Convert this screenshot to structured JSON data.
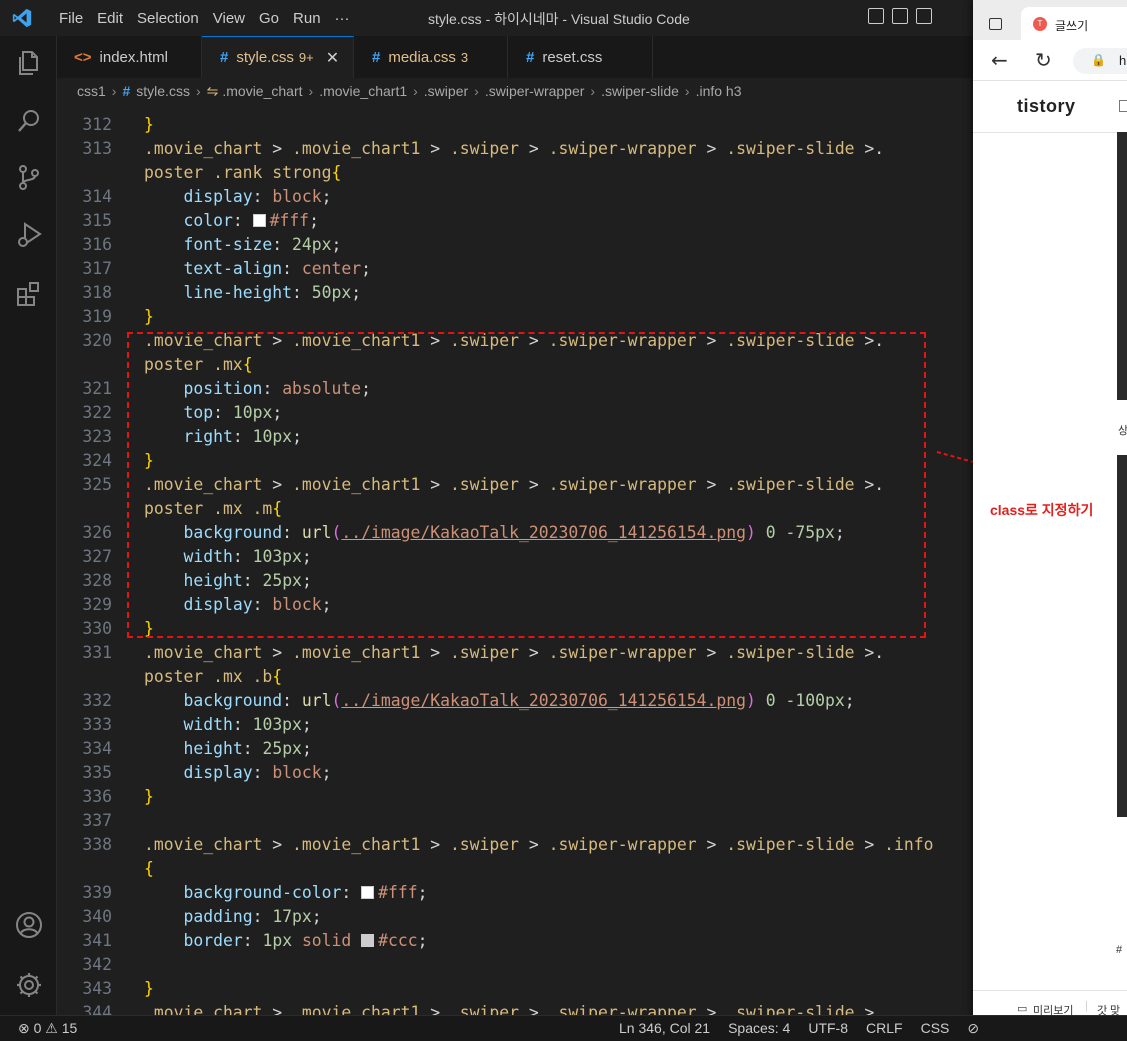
{
  "window": {
    "title": "style.css - 하이시네마 - Visual Studio Code",
    "menu": [
      "File",
      "Edit",
      "Selection",
      "View",
      "Go",
      "Run",
      "···"
    ]
  },
  "tabs": [
    {
      "label": "index.html",
      "icon": "<>",
      "badge": "",
      "active": false
    },
    {
      "label": "style.css",
      "icon": "#",
      "badge": "9+",
      "active": true,
      "close": "✕"
    },
    {
      "label": "media.css",
      "icon": "#",
      "badge": "3",
      "active": false
    },
    {
      "label": "reset.css",
      "icon": "#",
      "badge": "",
      "active": false
    }
  ],
  "breadcrumb": [
    "css1",
    "style.css",
    ".movie_chart",
    ".movie_chart1",
    ".swiper",
    ".swiper-wrapper",
    ".swiper-slide",
    ".info h3"
  ],
  "code_lines": [
    {
      "n": "312",
      "t": [
        [
          "brace",
          "}"
        ]
      ]
    },
    {
      "n": "313",
      "t": [
        [
          "sel",
          ".movie_chart"
        ],
        [
          "op",
          " > "
        ],
        [
          "sel",
          ".movie_chart1"
        ],
        [
          "op",
          " > "
        ],
        [
          "sel",
          ".swiper"
        ],
        [
          "op",
          " > "
        ],
        [
          "sel",
          ".swiper-wrapper"
        ],
        [
          "op",
          " > "
        ],
        [
          "sel",
          ".swiper-slide"
        ],
        [
          "op",
          " >."
        ]
      ]
    },
    {
      "n": "",
      "t": [
        [
          "sel",
          "poster .rank strong"
        ],
        [
          "brace",
          "{"
        ]
      ]
    },
    {
      "n": "314",
      "t": [
        [
          "op",
          "    "
        ],
        [
          "prop",
          "display"
        ],
        [
          "op",
          ": "
        ],
        [
          "val",
          "block"
        ],
        [
          "op",
          ";"
        ]
      ]
    },
    {
      "n": "315",
      "t": [
        [
          "op",
          "    "
        ],
        [
          "prop",
          "color"
        ],
        [
          "op",
          ": "
        ],
        [
          "swatch",
          "#ffffff"
        ],
        [
          "val",
          "#fff"
        ],
        [
          "op",
          ";"
        ]
      ]
    },
    {
      "n": "316",
      "t": [
        [
          "op",
          "    "
        ],
        [
          "prop",
          "font-size"
        ],
        [
          "op",
          ": "
        ],
        [
          "num",
          "24px"
        ],
        [
          "op",
          ";"
        ]
      ]
    },
    {
      "n": "317",
      "t": [
        [
          "op",
          "    "
        ],
        [
          "prop",
          "text-align"
        ],
        [
          "op",
          ": "
        ],
        [
          "val",
          "center"
        ],
        [
          "op",
          ";"
        ]
      ]
    },
    {
      "n": "318",
      "t": [
        [
          "op",
          "    "
        ],
        [
          "prop",
          "line-height"
        ],
        [
          "op",
          ": "
        ],
        [
          "num",
          "50px"
        ],
        [
          "op",
          ";"
        ]
      ]
    },
    {
      "n": "319",
      "t": [
        [
          "brace",
          "}"
        ]
      ]
    },
    {
      "n": "320",
      "t": [
        [
          "sel",
          ".movie_chart"
        ],
        [
          "op",
          " > "
        ],
        [
          "sel",
          ".movie_chart1"
        ],
        [
          "op",
          " > "
        ],
        [
          "sel",
          ".swiper"
        ],
        [
          "op",
          " > "
        ],
        [
          "sel",
          ".swiper-wrapper"
        ],
        [
          "op",
          " > "
        ],
        [
          "sel",
          ".swiper-slide"
        ],
        [
          "op",
          " >."
        ]
      ]
    },
    {
      "n": "",
      "t": [
        [
          "sel",
          "poster .mx"
        ],
        [
          "brace",
          "{"
        ]
      ]
    },
    {
      "n": "321",
      "t": [
        [
          "op",
          "    "
        ],
        [
          "prop",
          "position"
        ],
        [
          "op",
          ": "
        ],
        [
          "val",
          "absolute"
        ],
        [
          "op",
          ";"
        ]
      ]
    },
    {
      "n": "322",
      "t": [
        [
          "op",
          "    "
        ],
        [
          "prop",
          "top"
        ],
        [
          "op",
          ": "
        ],
        [
          "num",
          "10px"
        ],
        [
          "op",
          ";"
        ]
      ]
    },
    {
      "n": "323",
      "t": [
        [
          "op",
          "    "
        ],
        [
          "prop",
          "right"
        ],
        [
          "op",
          ": "
        ],
        [
          "num",
          "10px"
        ],
        [
          "op",
          ";"
        ]
      ]
    },
    {
      "n": "324",
      "t": [
        [
          "brace",
          "}"
        ]
      ]
    },
    {
      "n": "325",
      "t": [
        [
          "sel",
          ".movie_chart"
        ],
        [
          "op",
          " > "
        ],
        [
          "sel",
          ".movie_chart1"
        ],
        [
          "op",
          " > "
        ],
        [
          "sel",
          ".swiper"
        ],
        [
          "op",
          " > "
        ],
        [
          "sel",
          ".swiper-wrapper"
        ],
        [
          "op",
          " > "
        ],
        [
          "sel",
          ".swiper-slide"
        ],
        [
          "op",
          " >."
        ]
      ]
    },
    {
      "n": "",
      "t": [
        [
          "sel",
          "poster .mx .m"
        ],
        [
          "brace",
          "{"
        ]
      ]
    },
    {
      "n": "326",
      "t": [
        [
          "op",
          "    "
        ],
        [
          "prop",
          "background"
        ],
        [
          "op",
          ": "
        ],
        [
          "fn",
          "url"
        ],
        [
          "paren",
          "("
        ],
        [
          "url",
          "../image/KakaoTalk_20230706_141256154.png"
        ],
        [
          "paren",
          ")"
        ],
        [
          "op",
          " "
        ],
        [
          "num",
          "0"
        ],
        [
          "op",
          " "
        ],
        [
          "num",
          "-75px"
        ],
        [
          "op",
          ";"
        ]
      ]
    },
    {
      "n": "327",
      "t": [
        [
          "op",
          "    "
        ],
        [
          "prop",
          "width"
        ],
        [
          "op",
          ": "
        ],
        [
          "num",
          "103px"
        ],
        [
          "op",
          ";"
        ]
      ]
    },
    {
      "n": "328",
      "t": [
        [
          "op",
          "    "
        ],
        [
          "prop",
          "height"
        ],
        [
          "op",
          ": "
        ],
        [
          "num",
          "25px"
        ],
        [
          "op",
          ";"
        ]
      ]
    },
    {
      "n": "329",
      "t": [
        [
          "op",
          "    "
        ],
        [
          "prop",
          "display"
        ],
        [
          "op",
          ": "
        ],
        [
          "val",
          "block"
        ],
        [
          "op",
          ";"
        ]
      ]
    },
    {
      "n": "330",
      "t": [
        [
          "brace",
          "}"
        ]
      ]
    },
    {
      "n": "331",
      "t": [
        [
          "sel",
          ".movie_chart"
        ],
        [
          "op",
          " > "
        ],
        [
          "sel",
          ".movie_chart1"
        ],
        [
          "op",
          " > "
        ],
        [
          "sel",
          ".swiper"
        ],
        [
          "op",
          " > "
        ],
        [
          "sel",
          ".swiper-wrapper"
        ],
        [
          "op",
          " > "
        ],
        [
          "sel",
          ".swiper-slide"
        ],
        [
          "op",
          " >."
        ]
      ]
    },
    {
      "n": "",
      "t": [
        [
          "sel",
          "poster .mx .b"
        ],
        [
          "brace",
          "{"
        ]
      ]
    },
    {
      "n": "332",
      "t": [
        [
          "op",
          "    "
        ],
        [
          "prop",
          "background"
        ],
        [
          "op",
          ": "
        ],
        [
          "fn",
          "url"
        ],
        [
          "paren",
          "("
        ],
        [
          "url",
          "../image/KakaoTalk_20230706_141256154.png"
        ],
        [
          "paren",
          ")"
        ],
        [
          "op",
          " "
        ],
        [
          "num",
          "0"
        ],
        [
          "op",
          " "
        ],
        [
          "num",
          "-100px"
        ],
        [
          "op",
          ";"
        ]
      ]
    },
    {
      "n": "333",
      "t": [
        [
          "op",
          "    "
        ],
        [
          "prop",
          "width"
        ],
        [
          "op",
          ": "
        ],
        [
          "num",
          "103px"
        ],
        [
          "op",
          ";"
        ]
      ]
    },
    {
      "n": "334",
      "t": [
        [
          "op",
          "    "
        ],
        [
          "prop",
          "height"
        ],
        [
          "op",
          ": "
        ],
        [
          "num",
          "25px"
        ],
        [
          "op",
          ";"
        ]
      ]
    },
    {
      "n": "335",
      "t": [
        [
          "op",
          "    "
        ],
        [
          "prop",
          "display"
        ],
        [
          "op",
          ": "
        ],
        [
          "val",
          "block"
        ],
        [
          "op",
          ";"
        ]
      ]
    },
    {
      "n": "336",
      "t": [
        [
          "brace",
          "}"
        ]
      ]
    },
    {
      "n": "337",
      "t": []
    },
    {
      "n": "338",
      "t": [
        [
          "sel",
          ".movie_chart"
        ],
        [
          "op",
          " > "
        ],
        [
          "sel",
          ".movie_chart1"
        ],
        [
          "op",
          " > "
        ],
        [
          "sel",
          ".swiper"
        ],
        [
          "op",
          " > "
        ],
        [
          "sel",
          ".swiper-wrapper"
        ],
        [
          "op",
          " > "
        ],
        [
          "sel",
          ".swiper-slide"
        ],
        [
          "op",
          " > "
        ],
        [
          "sel",
          ".info"
        ]
      ]
    },
    {
      "n": "",
      "t": [
        [
          "brace",
          "{"
        ]
      ]
    },
    {
      "n": "339",
      "t": [
        [
          "op",
          "    "
        ],
        [
          "prop",
          "background-color"
        ],
        [
          "op",
          ": "
        ],
        [
          "swatch",
          "#ffffff"
        ],
        [
          "val",
          "#fff"
        ],
        [
          "op",
          ";"
        ]
      ]
    },
    {
      "n": "340",
      "t": [
        [
          "op",
          "    "
        ],
        [
          "prop",
          "padding"
        ],
        [
          "op",
          ": "
        ],
        [
          "num",
          "17px"
        ],
        [
          "op",
          ";"
        ]
      ]
    },
    {
      "n": "341",
      "t": [
        [
          "op",
          "    "
        ],
        [
          "prop",
          "border"
        ],
        [
          "op",
          ": "
        ],
        [
          "num",
          "1px"
        ],
        [
          "op",
          " "
        ],
        [
          "val",
          "solid"
        ],
        [
          "op",
          " "
        ],
        [
          "swatch",
          "#cccccc"
        ],
        [
          "val",
          "#ccc"
        ],
        [
          "op",
          ";"
        ]
      ]
    },
    {
      "n": "342",
      "t": []
    },
    {
      "n": "343",
      "t": [
        [
          "brace",
          "}"
        ]
      ]
    },
    {
      "n": "344",
      "t": [
        [
          "sel",
          ".movie_chart"
        ],
        [
          "op",
          " > "
        ],
        [
          "sel",
          ".movie_chart1"
        ],
        [
          "op",
          " > "
        ],
        [
          "sel",
          ".swiper"
        ],
        [
          "op",
          " > "
        ],
        [
          "sel",
          ".swiper-wrapper"
        ],
        [
          "op",
          " > "
        ],
        [
          "sel",
          ".swiper-slide"
        ],
        [
          "op",
          " >"
        ]
      ]
    }
  ],
  "annotation": "class로 지정하기",
  "browser": {
    "tab_title": "글쓰기",
    "url_fragment": "h",
    "logo": "tistory",
    "bottom_preview": "미리보기",
    "bottom_save": "맞춤"
  },
  "statusbar": {
    "problems": "⊗ 0 ⚠ 15",
    "position": "Ln 346, Col 21",
    "spaces": "Spaces: 4",
    "encoding": "UTF-8",
    "eol": "CRLF",
    "language": "CSS"
  },
  "colors": {
    "accent": "#0078d4",
    "annotation": "#e0211d"
  }
}
